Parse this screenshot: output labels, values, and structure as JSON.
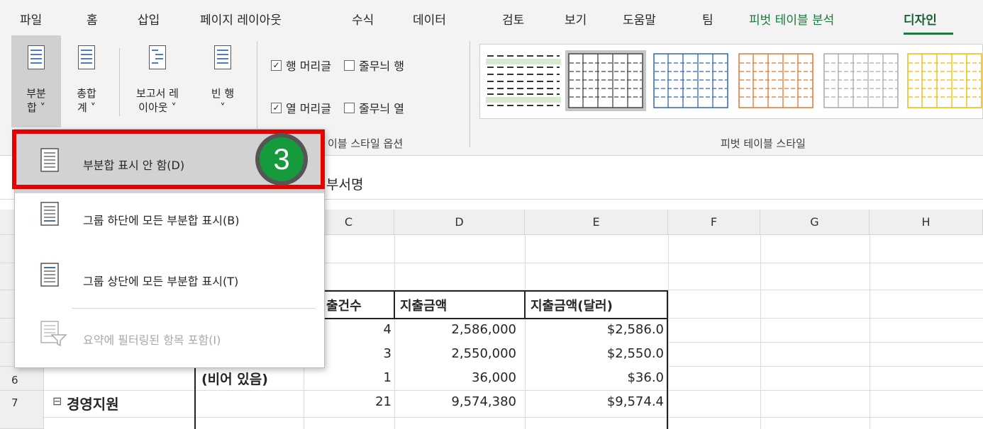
{
  "tabs": [
    "파일",
    "홈",
    "삽입",
    "페이지 레이아웃",
    "수식",
    "데이터",
    "검토",
    "보기",
    "도움말",
    "팀",
    "피벗 테이블 분석",
    "디자인"
  ],
  "ribbon": {
    "subtotals_l1": "부분",
    "subtotals_l2": "합 ˅",
    "grand_l1": "총합",
    "grand_l2": "계 ˅",
    "report_l1": "보고서 레",
    "report_l2": "이아웃 ˅",
    "blank_l1": "빈 행",
    "blank_l2": "˅",
    "row_headers": "행 머리글",
    "banded_rows": "줄무늬 행",
    "col_headers": "열 머리글",
    "banded_cols": "줄무늬 열",
    "check_mark": "✓",
    "style_options_label": "이블 스타일 옵션",
    "styles_label": "피벗 테이블 스타일"
  },
  "formula_bar": {
    "text": "부서명"
  },
  "grid": {
    "columns": [
      "C",
      "D",
      "E",
      "F",
      "G",
      "H"
    ],
    "row_numbers": [
      "6",
      "7"
    ],
    "headers": {
      "c": "출건수",
      "d": "지출금액",
      "e": "지출금액(달러)"
    },
    "rows": [
      {
        "c": "4",
        "d": "2,586,000",
        "e": "$2,586.0"
      },
      {
        "c": "3",
        "d": "2,550,000",
        "e": "$2,550.0"
      },
      {
        "b": "(비어 있음)",
        "c": "1",
        "d": "36,000",
        "e": "$36.0"
      },
      {
        "a": "경영지원",
        "c": "21",
        "d": "9,574,380",
        "e": "$9,574.4"
      }
    ],
    "collapse_sign": "⊟"
  },
  "menu": {
    "items": [
      {
        "label": "부분합 표시 안 함(D)"
      },
      {
        "label": "그룹 하단에 모든 부분합 표시(B)"
      },
      {
        "label": "그룹 상단에 모든 부분합 표시(T)"
      },
      {
        "label": "요약에 필터링된 항목 포함(I)"
      }
    ]
  },
  "callout": {
    "number": "3"
  },
  "colors": {
    "accent_green": "#1b7a3c",
    "highlight_red": "#e60000",
    "badge_green": "#159a3c"
  }
}
